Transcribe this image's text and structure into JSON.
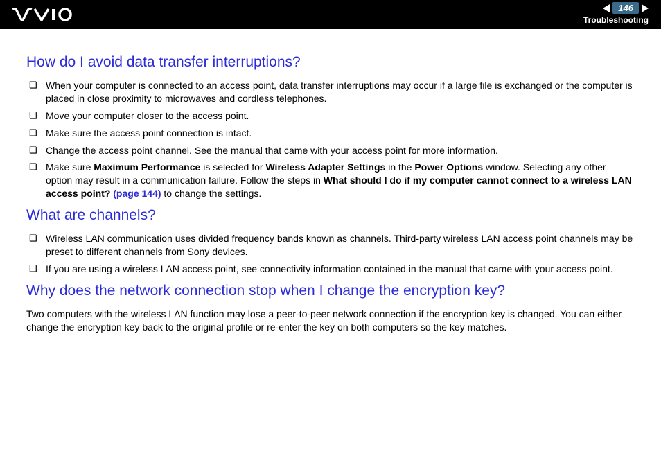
{
  "header": {
    "page_number": "146",
    "section": "Troubleshooting"
  },
  "sections": {
    "s1": {
      "title": "How do I avoid data transfer interruptions?",
      "items": [
        "When your computer is connected to an access point, data transfer interruptions may occur if a large file is exchanged or the computer is placed in close proximity to microwaves and cordless telephones.",
        "Move your computer closer to the access point.",
        "Make sure the access point connection is intact.",
        "Change the access point channel. See the manual that came with your access point for more information."
      ],
      "item5_pre": "Make sure ",
      "item5_b1": "Maximum Performance",
      "item5_m1": " is selected for ",
      "item5_b2": "Wireless Adapter Settings",
      "item5_m2": " in the ",
      "item5_b3": "Power Options",
      "item5_m3": " window. Selecting any other option may result in a communication failure. Follow the steps in ",
      "item5_b4": "What should I do if my computer cannot connect to a wireless LAN access point?",
      "item5_link": " (page 144)",
      "item5_post": " to change the settings."
    },
    "s2": {
      "title": "What are channels?",
      "items": [
        "Wireless LAN communication uses divided frequency bands known as channels. Third-party wireless LAN access point channels may be preset to different channels from Sony devices.",
        "If you are using a wireless LAN access point, see connectivity information contained in the manual that came with your access point."
      ]
    },
    "s3": {
      "title": "Why does the network connection stop when I change the encryption key?",
      "body": "Two computers with the wireless LAN function may lose a peer-to-peer network connection if the encryption key is changed. You can either change the encryption key back to the original profile or re-enter the key on both computers so the key matches."
    }
  }
}
